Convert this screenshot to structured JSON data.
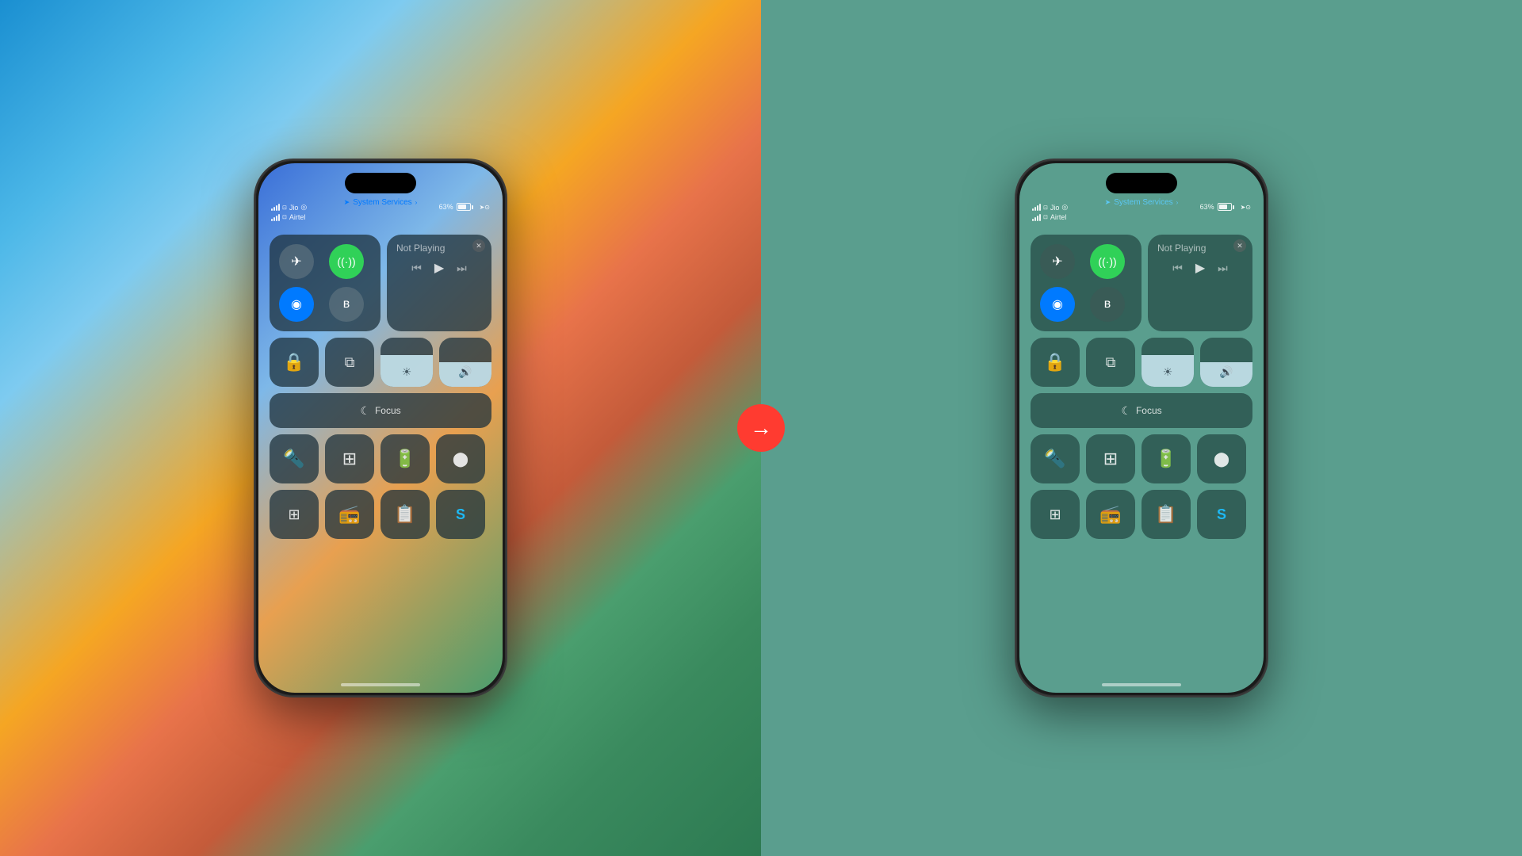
{
  "left_phone": {
    "status": {
      "carrier1": "Jio",
      "carrier2": "Airtel",
      "battery": "63%",
      "system_services": "System Services"
    },
    "media": {
      "not_playing": "Not Playing"
    },
    "focus": {
      "label": "Focus"
    },
    "connectivity": {
      "airplane_icon": "✈",
      "cellular_icon": "📶",
      "wifi_icon": "📶",
      "bluetooth_icon": "🔵"
    }
  },
  "right_phone": {
    "status": {
      "carrier1": "Jio",
      "carrier2": "Airtel",
      "battery": "63%",
      "system_services": "System Services"
    },
    "media": {
      "not_playing": "Not Playing"
    },
    "focus": {
      "label": "Focus"
    }
  },
  "arrow": {
    "symbol": "→"
  },
  "icons": {
    "airplane": "✈",
    "cellular": "((·))",
    "wifi": "◉",
    "bluetooth": "ʙ",
    "lock_rotation": "🔒",
    "screen_mirror": "⧉",
    "brightness": "☀",
    "volume": "🔊",
    "moon": "☾",
    "flashlight": "🔦",
    "calculator": "⊞",
    "battery_saver": "🔋",
    "screen_record": "⬤",
    "qr_code": "⊞",
    "remote": "📻",
    "notes": "📋",
    "shazam": "S"
  }
}
